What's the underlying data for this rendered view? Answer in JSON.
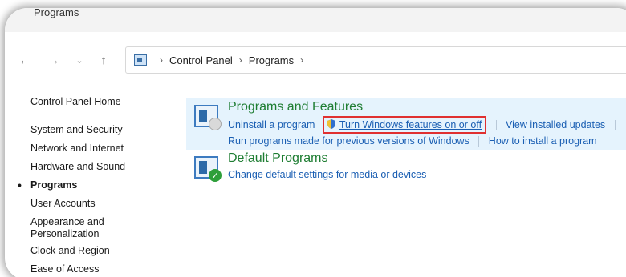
{
  "window": {
    "title": "Programs"
  },
  "nav": {
    "back_icon": "arrow-left-icon",
    "forward_icon": "arrow-right-icon",
    "recent_icon": "chevron-down-icon",
    "up_icon": "arrow-up-icon"
  },
  "address": {
    "crumbs": [
      "Control Panel",
      "Programs"
    ]
  },
  "sidebar": {
    "items": [
      {
        "label": "Control Panel Home"
      },
      {
        "label": "System and Security"
      },
      {
        "label": "Network and Internet"
      },
      {
        "label": "Hardware and Sound"
      },
      {
        "label": "Programs",
        "active": true
      },
      {
        "label": "User Accounts"
      },
      {
        "label": "Appearance and Personalization"
      },
      {
        "label": "Clock and Region"
      },
      {
        "label": "Ease of Access"
      }
    ]
  },
  "categories": {
    "programs_features": {
      "title": "Programs and Features",
      "uninstall": "Uninstall a program",
      "windows_features": "Turn Windows features on or off",
      "installed_updates": "View installed updates",
      "run_previous": "Run programs made for previous versions of Windows",
      "how_install": "How to install a program"
    },
    "default_programs": {
      "title": "Default Programs",
      "change_defaults": "Change default settings for media or devices"
    }
  },
  "colors": {
    "link": "#1b5fb3",
    "category_title": "#1e7d32",
    "highlight_bg": "#e5f3fd",
    "annotation_box": "#e03030"
  }
}
